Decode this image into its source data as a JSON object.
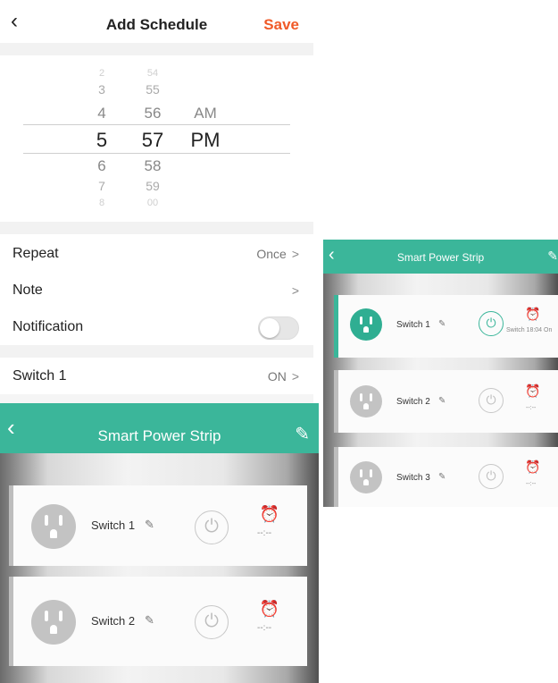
{
  "schedule": {
    "title": "Add Schedule",
    "save_label": "Save",
    "picker": {
      "hours_above": [
        "2",
        "3",
        "4"
      ],
      "hour_selected": "5",
      "hours_below": [
        "6",
        "7",
        "8"
      ],
      "minutes_above": [
        "54",
        "55",
        "56"
      ],
      "minute_selected": "57",
      "minutes_below": [
        "58",
        "59",
        "00"
      ],
      "ampm_above": "AM",
      "ampm_selected": "PM"
    },
    "rows": {
      "repeat_label": "Repeat",
      "repeat_value": "Once",
      "note_label": "Note",
      "notification_label": "Notification",
      "notification_on": false,
      "switch_label": "Switch 1",
      "switch_value": "ON"
    },
    "colors": {
      "accent": "#f05a28"
    }
  },
  "strip_large": {
    "title": "Smart Power Strip",
    "switches": [
      {
        "name": "Switch 1",
        "time": "--:--"
      },
      {
        "name": "Switch 2",
        "time": "--:--"
      }
    ]
  },
  "strip_small": {
    "title": "Smart Power Strip",
    "switches": [
      {
        "name": "Switch 1",
        "time": "Switch 18:04 On",
        "on": true
      },
      {
        "name": "Switch 2",
        "time": "--:--",
        "on": false
      },
      {
        "name": "Switch 3",
        "time": "--:--",
        "on": false
      }
    ]
  },
  "colors": {
    "teal": "#3bb69a"
  }
}
